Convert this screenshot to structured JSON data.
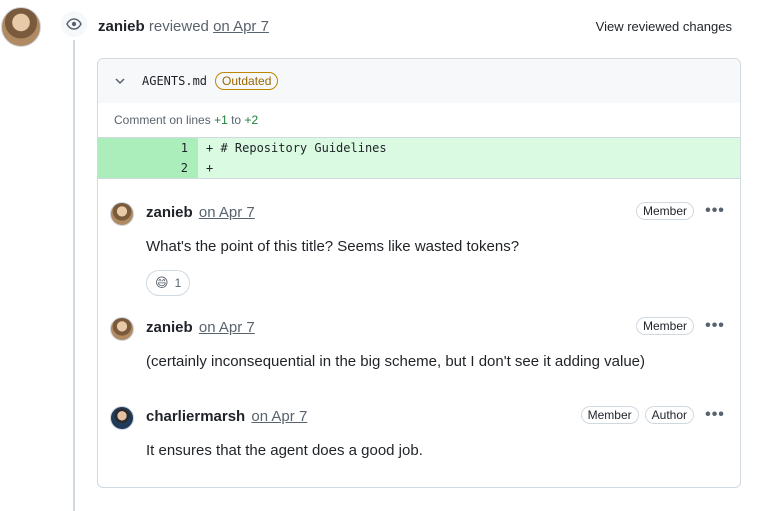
{
  "review": {
    "user": "zanieb",
    "action": "reviewed",
    "date": "on Apr 7",
    "view_changes": "View reviewed changes"
  },
  "file": {
    "name": "AGENTS.md",
    "badge": "Outdated",
    "comment_on_prefix": "Comment on lines",
    "line_from": "+1",
    "to_word": "to",
    "line_to": "+2"
  },
  "diff": [
    {
      "num": "1",
      "code": "+ # Repository Guidelines"
    },
    {
      "num": "2",
      "code": "+"
    }
  ],
  "comments": [
    {
      "user": "zanieb",
      "date": "on Apr 7",
      "roles": [
        "Member"
      ],
      "body": "What's the point of this title? Seems like wasted tokens?",
      "reaction": {
        "emoji": "😄",
        "count": "1"
      }
    },
    {
      "user": "zanieb",
      "date": "on Apr 7",
      "roles": [
        "Member"
      ],
      "body": "(certainly inconsequential in the big scheme, but I don't see it adding value)"
    },
    {
      "user": "charliermarsh",
      "date": "on Apr 7",
      "roles": [
        "Member",
        "Author"
      ],
      "body": "It ensures that the agent does a good job."
    }
  ],
  "icons": {
    "eye": "eye-icon",
    "chevron": "chevron-down-icon",
    "kebab": "kebab-horizontal-icon",
    "kebab_glyph": "•••"
  }
}
